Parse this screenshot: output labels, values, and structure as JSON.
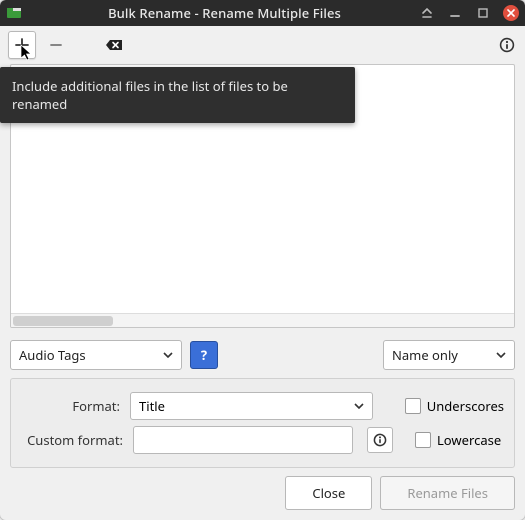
{
  "window": {
    "title": "Bulk Rename - Rename Multiple Files"
  },
  "toolbar": {
    "tooltip_add": "Include additional files in the list of files to be renamed"
  },
  "controls": {
    "mode_combo": "Audio Tags",
    "column_combo": "Name only",
    "help_label": "?"
  },
  "options": {
    "format_label": "Format:",
    "format_value": "Title",
    "custom_format_label": "Custom format:",
    "custom_format_value": "",
    "underscores_label": "Underscores",
    "lowercase_label": "Lowercase"
  },
  "buttons": {
    "close": "Close",
    "rename": "Rename Files"
  }
}
